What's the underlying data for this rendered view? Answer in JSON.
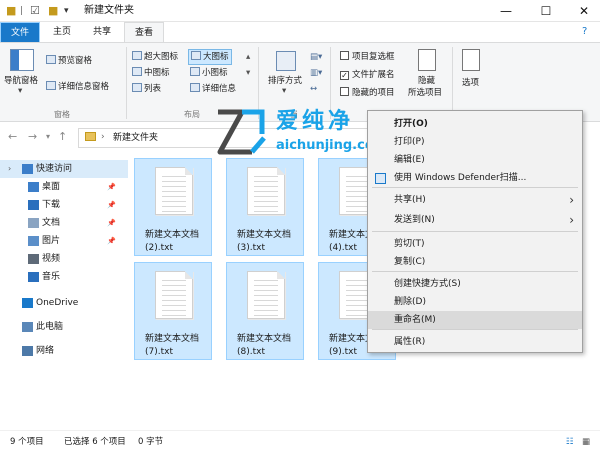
{
  "window": {
    "title": "新建文件夹",
    "controls": [
      "—",
      "☐",
      "✕"
    ]
  },
  "ribbon_tabs": [
    "文件",
    "主页",
    "共享",
    "查看"
  ],
  "ribbon": {
    "nav_pane": "导航窗格",
    "preview_pane": "预览窗格",
    "details_pane": "详细信息窗格",
    "group_panes": "窗格",
    "layout_items": [
      "超大图标",
      "大图标",
      "中图标",
      "小图标",
      "列表",
      "详细信息"
    ],
    "group_layout": "布局",
    "sort_by": "排序方式",
    "group_current": "当",
    "checkboxes": [
      {
        "label": "项目复选框",
        "checked": false
      },
      {
        "label": "文件扩展名",
        "checked": true
      },
      {
        "label": "隐藏的项目",
        "checked": false
      }
    ],
    "hide_selected": "隐藏",
    "hide_selected_2": "所选项目",
    "options": "选项"
  },
  "address": {
    "path": "新建文件夹"
  },
  "sidebar": {
    "items": [
      {
        "label": "快速访问",
        "icon": "star-icon",
        "pinned": false
      },
      {
        "label": "桌面",
        "icon": "desktop-icon",
        "pinned": true
      },
      {
        "label": "下载",
        "icon": "download-icon",
        "pinned": true
      },
      {
        "label": "文档",
        "icon": "document-icon",
        "pinned": true
      },
      {
        "label": "图片",
        "icon": "picture-icon",
        "pinned": true
      },
      {
        "label": "视频",
        "icon": "video-icon",
        "pinned": false
      },
      {
        "label": "音乐",
        "icon": "music-icon",
        "pinned": false
      },
      {
        "label": "OneDrive",
        "icon": "cloud-icon",
        "pinned": false
      },
      {
        "label": "此电脑",
        "icon": "computer-icon",
        "pinned": false
      },
      {
        "label": "网络",
        "icon": "network-icon",
        "pinned": false
      }
    ]
  },
  "files": [
    {
      "line1": "新建文本文档",
      "line2": "(2).txt"
    },
    {
      "line1": "新建文本文档",
      "line2": "(3).txt"
    },
    {
      "line1": "新建文本文档",
      "line2": "(4).txt"
    },
    {
      "line1": "新建文本文档",
      "line2": "(7).txt"
    },
    {
      "line1": "新建文本文档",
      "line2": "(8).txt"
    },
    {
      "line1": "新建文本文档",
      "line2": "(9).txt"
    }
  ],
  "context_menu": {
    "items": [
      {
        "label": "打开(O)",
        "bold": true
      },
      {
        "label": "打印(P)"
      },
      {
        "label": "编辑(E)"
      },
      {
        "label": "使用 Windows Defender扫描..."
      },
      {
        "label": "共享(H)",
        "submenu": true
      },
      {
        "label": "发送到(N)",
        "submenu": true
      },
      {
        "label": "剪切(T)"
      },
      {
        "label": "复制(C)"
      },
      {
        "label": "创建快捷方式(S)"
      },
      {
        "label": "删除(D)"
      },
      {
        "label": "重命名(M)",
        "highlighted": true
      },
      {
        "label": "属性(R)"
      }
    ]
  },
  "status": {
    "count": "9 个项目",
    "selected": "已选择 6 个项目",
    "size": "0 字节"
  },
  "watermark": {
    "big": "爱纯净",
    "small": "aichunjing.com"
  },
  "colors": {
    "accent": "#1979ca",
    "selection": "#cce8ff",
    "watermark": "#1aa3e8"
  }
}
